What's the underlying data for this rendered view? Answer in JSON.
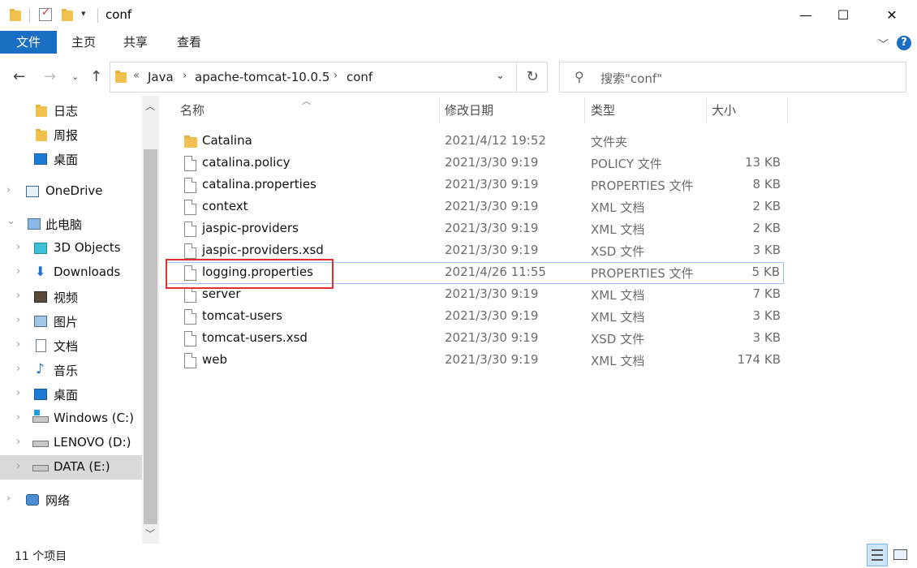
{
  "window": {
    "title": "conf",
    "controls": {
      "minimize": "—",
      "maximize": "☐",
      "close": "✕"
    }
  },
  "ribbon": {
    "file_tab": "文件",
    "tabs": [
      "主页",
      "共享",
      "查看"
    ],
    "help": "?"
  },
  "address": {
    "overflow": "«",
    "crumbs": [
      "Java",
      "apache-tomcat-10.0.5",
      "conf"
    ],
    "separator": "›"
  },
  "search": {
    "placeholder": "搜索\"conf\""
  },
  "navpane": {
    "items": [
      {
        "label": "日志",
        "icon": "folder-icon"
      },
      {
        "label": "周报",
        "icon": "folder-icon"
      },
      {
        "label": "桌面",
        "icon": "desktop-icon"
      },
      {
        "label": "OneDrive",
        "icon": "onedrive-icon"
      },
      {
        "label": "此电脑",
        "icon": "pc-icon"
      },
      {
        "label": "3D Objects",
        "icon": "3d-objects-icon"
      },
      {
        "label": "Downloads",
        "icon": "downloads-icon"
      },
      {
        "label": "视频",
        "icon": "video-icon"
      },
      {
        "label": "图片",
        "icon": "pictures-icon"
      },
      {
        "label": "文档",
        "icon": "documents-icon"
      },
      {
        "label": "音乐",
        "icon": "music-icon"
      },
      {
        "label": "桌面",
        "icon": "desktop-icon"
      },
      {
        "label": "Windows (C:)",
        "icon": "drive-c-icon"
      },
      {
        "label": "LENOVO (D:)",
        "icon": "drive-icon"
      },
      {
        "label": "DATA (E:)",
        "icon": "drive-icon"
      },
      {
        "label": "网络",
        "icon": "network-icon"
      }
    ]
  },
  "columns": {
    "name": "名称",
    "date": "修改日期",
    "type": "类型",
    "size": "大小"
  },
  "files": [
    {
      "name": "Catalina",
      "date": "2021/4/12 19:52",
      "type": "文件夹",
      "size": ""
    },
    {
      "name": "catalina.policy",
      "date": "2021/3/30 9:19",
      "type": "POLICY 文件",
      "size": "13 KB"
    },
    {
      "name": "catalina.properties",
      "date": "2021/3/30 9:19",
      "type": "PROPERTIES 文件",
      "size": "8 KB"
    },
    {
      "name": "context",
      "date": "2021/3/30 9:19",
      "type": "XML 文档",
      "size": "2 KB"
    },
    {
      "name": "jaspic-providers",
      "date": "2021/3/30 9:19",
      "type": "XML 文档",
      "size": "2 KB"
    },
    {
      "name": "jaspic-providers.xsd",
      "date": "2021/3/30 9:19",
      "type": "XSD 文件",
      "size": "3 KB"
    },
    {
      "name": "logging.properties",
      "date": "2021/4/26 11:55",
      "type": "PROPERTIES 文件",
      "size": "5 KB"
    },
    {
      "name": "server",
      "date": "2021/3/30 9:19",
      "type": "XML 文档",
      "size": "7 KB"
    },
    {
      "name": "tomcat-users",
      "date": "2021/3/30 9:19",
      "type": "XML 文档",
      "size": "3 KB"
    },
    {
      "name": "tomcat-users.xsd",
      "date": "2021/3/30 9:19",
      "type": "XSD 文件",
      "size": "3 KB"
    },
    {
      "name": "web",
      "date": "2021/3/30 9:19",
      "type": "XML 文档",
      "size": "174 KB"
    }
  ],
  "status": {
    "count": "11 个项目"
  },
  "colors": {
    "accent": "#1a6fc4",
    "highlight_box": "#e03030",
    "selection_border": "#99c2f0"
  }
}
